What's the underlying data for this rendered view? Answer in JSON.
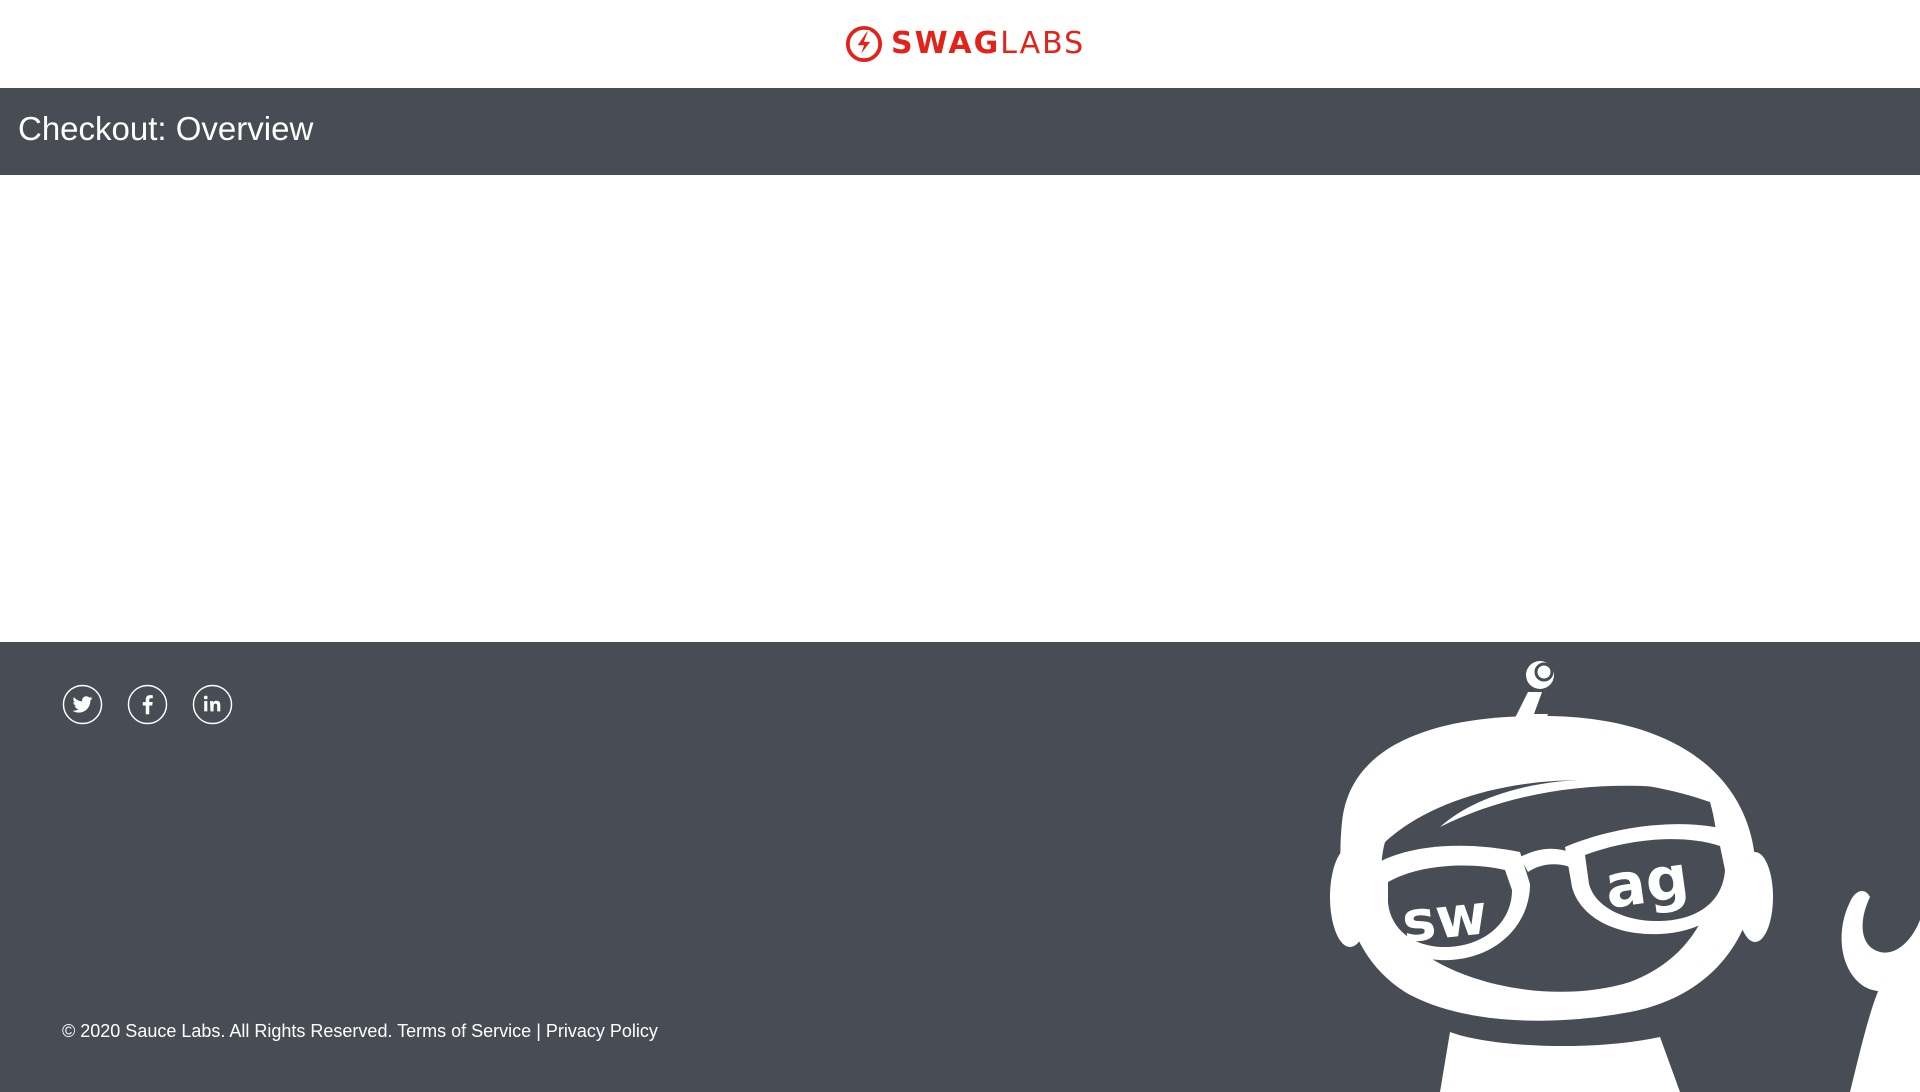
{
  "header": {
    "logo": {
      "brand_bold": "SWAG",
      "brand_light": "LABS",
      "icon": "bolt-circle-icon",
      "color": "#e2231a"
    }
  },
  "title_bar": {
    "title": "Checkout: Overview",
    "background": "#484c55"
  },
  "footer": {
    "background": "#484c55",
    "social": [
      {
        "name": "Twitter",
        "icon": "twitter-icon"
      },
      {
        "name": "Facebook",
        "icon": "facebook-icon"
      },
      {
        "name": "LinkedIn",
        "icon": "linkedin-icon"
      }
    ],
    "copyright_text": "© 2020 Sauce Labs. All Rights Reserved.",
    "terms_label": "Terms of Service",
    "separator": "|",
    "privacy_label": "Privacy Policy",
    "mascot": {
      "icon": "swag-robot-mascot",
      "lettering": "swag"
    }
  }
}
